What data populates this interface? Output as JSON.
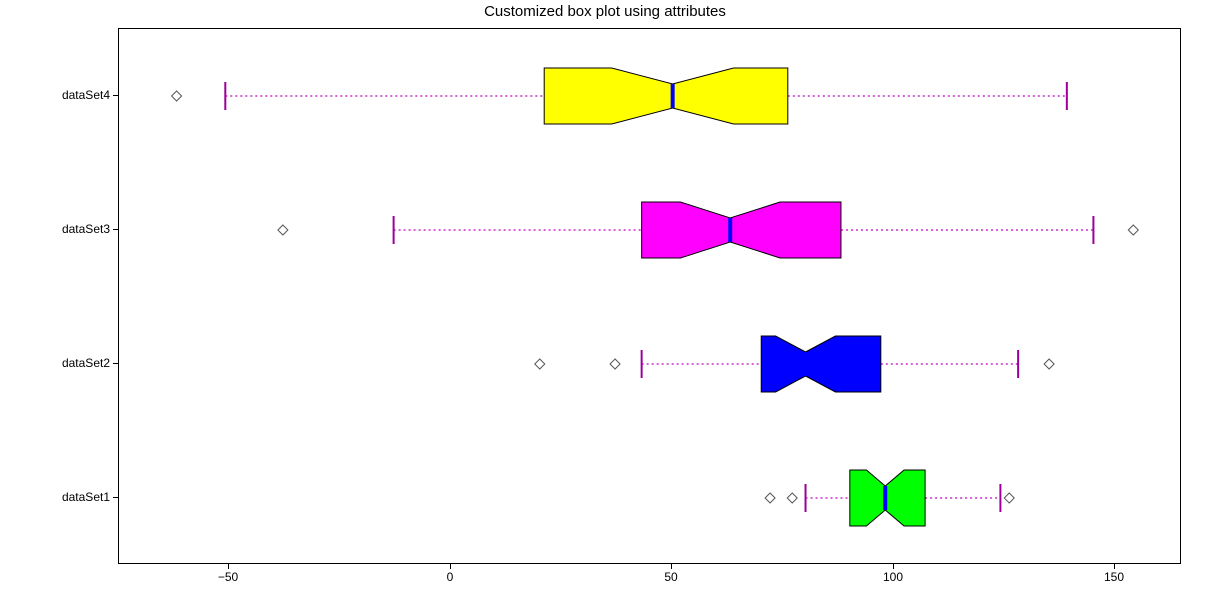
{
  "chart_data": {
    "type": "boxplot",
    "title": "Customized box plot using attributes",
    "orientation": "horizontal",
    "xlim": [
      -75,
      165
    ],
    "ylim": [
      0.5,
      4.5
    ],
    "x_ticks": [
      -50,
      0,
      50,
      100,
      150
    ],
    "x_tick_labels": [
      "−50",
      "0",
      "50",
      "100",
      "150"
    ],
    "y_tick_labels": [
      "dataSet1",
      "dataSet2",
      "dataSet3",
      "dataSet4"
    ],
    "series": [
      {
        "name": "dataSet1",
        "q1": 90,
        "median": 98,
        "q3": 107,
        "whisker_low": 80,
        "whisker_high": 124,
        "outliers": [
          72,
          77,
          126
        ],
        "fill": "#00ff00"
      },
      {
        "name": "dataSet2",
        "q1": 70,
        "median": 80,
        "q3": 97,
        "whisker_low": 43,
        "whisker_high": 128,
        "outliers": [
          20,
          37,
          135
        ],
        "fill": "#0000ff"
      },
      {
        "name": "dataSet3",
        "q1": 43,
        "median": 63,
        "q3": 88,
        "whisker_low": -13,
        "whisker_high": 145,
        "outliers": [
          -38,
          154
        ],
        "fill": "#ff00ff"
      },
      {
        "name": "dataSet4",
        "q1": 21,
        "median": 50,
        "q3": 76,
        "whisker_low": -51,
        "whisker_high": 139,
        "outliers": [
          -62
        ],
        "fill": "#ffff00"
      }
    ],
    "notched": true,
    "flier_marker": "diamond",
    "whisker_color": "#c000c0",
    "cap_color": "#9b009b",
    "median_color": "#0000ff"
  }
}
